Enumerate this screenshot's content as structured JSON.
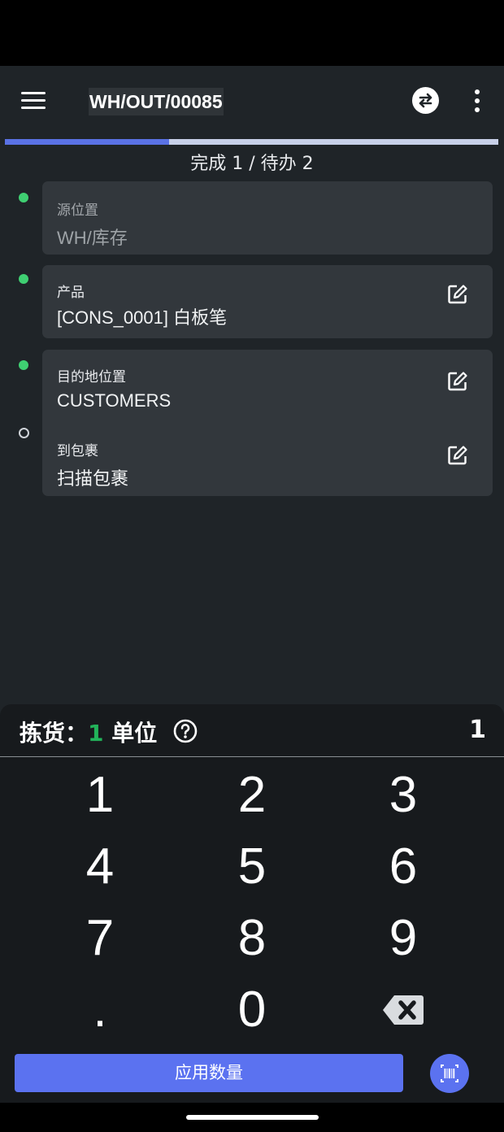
{
  "header": {
    "title": "WH/OUT/00085",
    "icons": {
      "menu": "menu-icon",
      "swap": "swap-icon",
      "more": "more-vert-icon"
    }
  },
  "progress": {
    "text": "完成 1 / 待办 2",
    "fraction": 0.333,
    "fill_color": "#5a72e5",
    "track_color": "#c7d0e8"
  },
  "fields": {
    "source": {
      "label": "源位置",
      "value": "WH/库存"
    },
    "product": {
      "label": "产品",
      "value": "[CONS_0001] 白板笔"
    },
    "destination": {
      "label": "目的地位置",
      "value": "CUSTOMERS"
    },
    "package": {
      "label": "到包裹",
      "value": "扫描包裹"
    }
  },
  "pick": {
    "prefix": "拣货：",
    "qty": "1",
    "unit": "单位",
    "count": "1"
  },
  "keypad": {
    "keys": [
      "1",
      "2",
      "3",
      "4",
      "5",
      "6",
      "7",
      "8",
      "9",
      ".",
      "0"
    ]
  },
  "actions": {
    "apply_label": "应用数量"
  },
  "colors": {
    "accent": "#5b72f0",
    "status_done": "#3fcf72",
    "qty_green": "#22b35a"
  }
}
